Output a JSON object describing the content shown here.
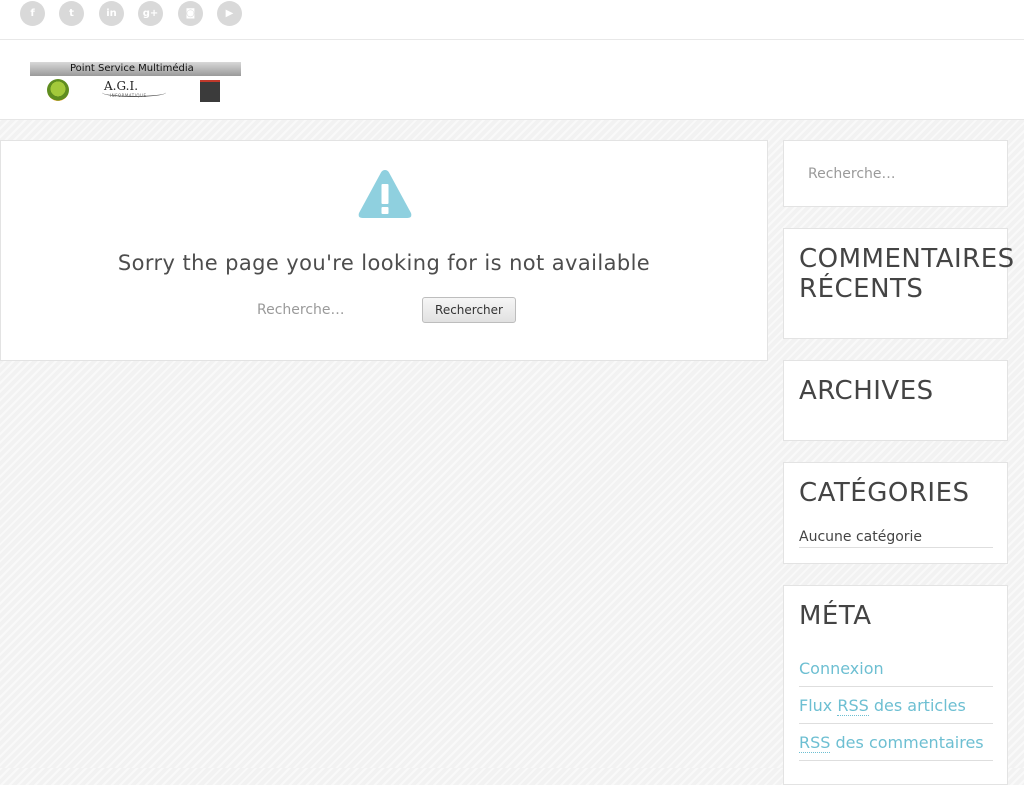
{
  "social": {
    "icons": [
      {
        "name": "facebook-icon",
        "glyph": "f"
      },
      {
        "name": "twitter-icon",
        "glyph": "t"
      },
      {
        "name": "linkedin-icon",
        "glyph": "in"
      },
      {
        "name": "google-plus-icon",
        "glyph": "g+"
      },
      {
        "name": "instagram-icon",
        "glyph": "◙"
      },
      {
        "name": "youtube-icon",
        "glyph": "▶"
      }
    ],
    "color": "#d9d9d9"
  },
  "logo": {
    "title": "Point Service Multimédia",
    "agi": "A.G.I.",
    "agi_sub": "INFORMATIQUE"
  },
  "main": {
    "message": "Sorry the page you're looking for is not available",
    "search_placeholder": "Recherche…",
    "search_button": "Rechercher",
    "warning_color": "#8fd0df"
  },
  "sidebar": {
    "search_placeholder": "Recherche…",
    "recent_comments": {
      "line1": "COMMENTAIRES",
      "line2": "RÉCENTS"
    },
    "archives": {
      "title": "ARCHIVES"
    },
    "categories": {
      "title": "CATÉGORIES",
      "items": [
        "Aucune catégorie"
      ]
    },
    "meta": {
      "title": "MÉTA",
      "login": "Connexion",
      "entries_prefix": "Flux ",
      "entries_abbr": "RSS",
      "entries_suffix": " des articles",
      "comments_abbr": "RSS",
      "comments_suffix": " des commentaires"
    }
  },
  "colors": {
    "accent": "#6dbfd2",
    "heading": "#444444",
    "background": "#f2f2f2"
  }
}
